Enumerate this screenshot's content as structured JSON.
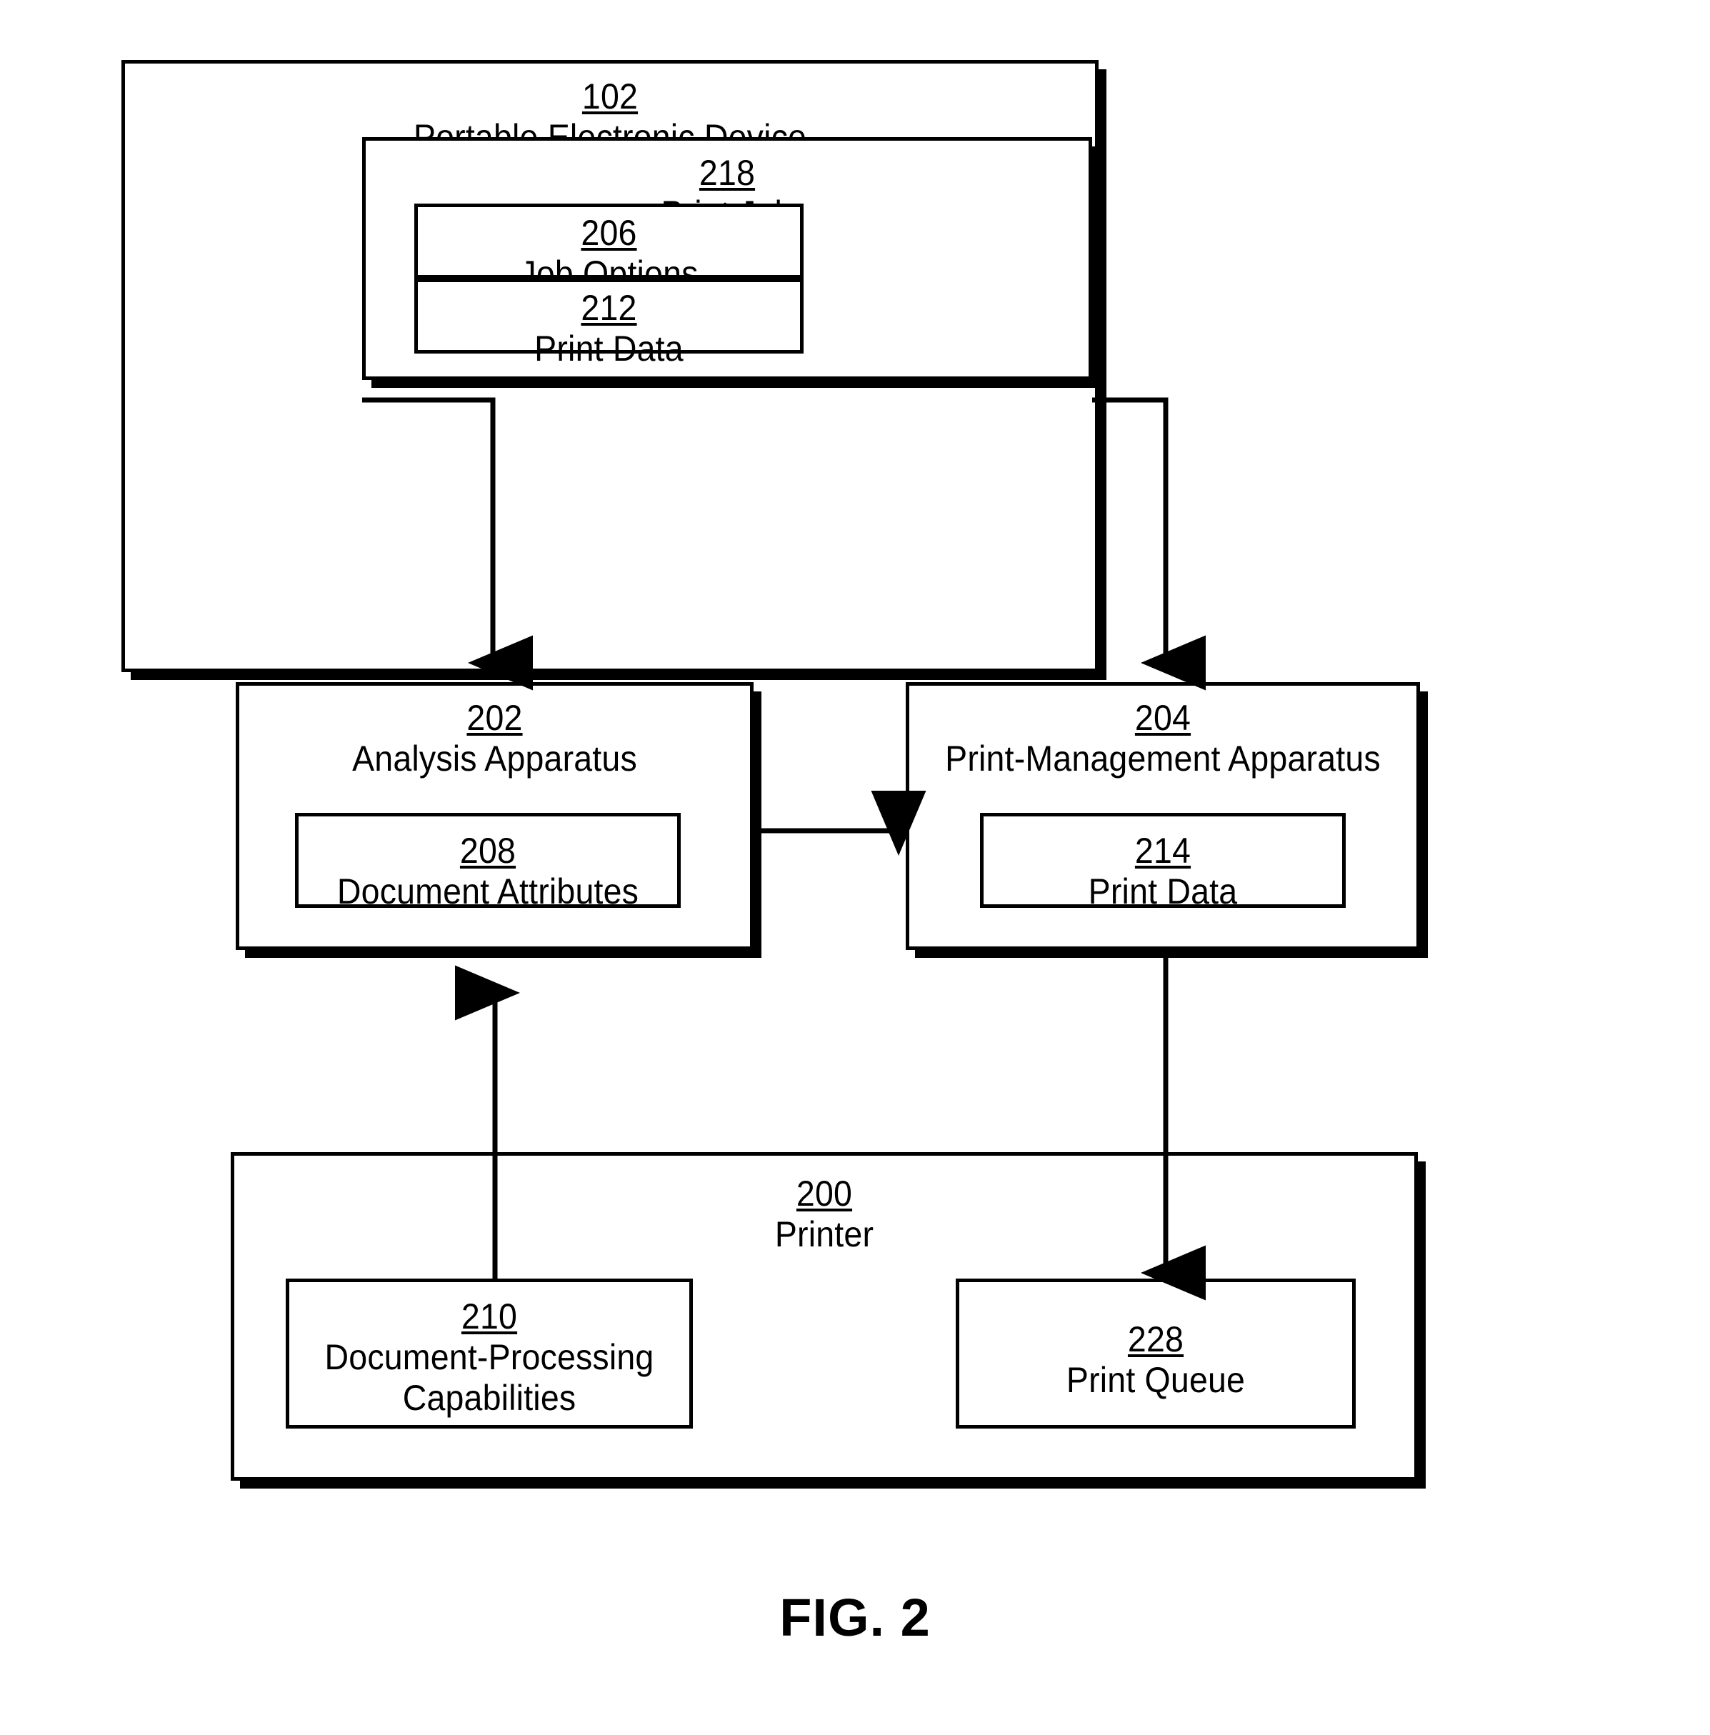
{
  "figure": {
    "caption": "FIG. 2"
  },
  "nodes": {
    "device": {
      "ref": "102",
      "name": "Portable Electronic Device"
    },
    "print_job": {
      "ref": "218",
      "name": "Print Job"
    },
    "job_options": {
      "ref": "206",
      "name": "Job Options"
    },
    "print_data_job": {
      "ref": "212",
      "name": "Print Data"
    },
    "analysis_apparatus": {
      "ref": "202",
      "name": "Analysis Apparatus"
    },
    "document_attributes": {
      "ref": "208",
      "name": "Document Attributes"
    },
    "print_management_apparatus": {
      "ref": "204",
      "name": "Print-Management Apparatus"
    },
    "print_data_mgmt": {
      "ref": "214",
      "name": "Print Data"
    },
    "printer": {
      "ref": "200",
      "name": "Printer"
    },
    "doc_processing_capabilities": {
      "ref": "210",
      "name": "Document-Processing\nCapabilities"
    },
    "print_queue": {
      "ref": "228",
      "name": "Print Queue"
    }
  },
  "connectors": [
    {
      "id": "job-options-to-analysis",
      "from": "job_options",
      "to": "analysis_apparatus",
      "style": "elbow-down-left",
      "arrow": "down"
    },
    {
      "id": "print-data-to-management",
      "from": "print_data_job",
      "to": "print_management_apparatus",
      "style": "elbow-down-right",
      "arrow": "down"
    },
    {
      "id": "analysis-to-management",
      "from": "analysis_apparatus",
      "to": "print_management_apparatus",
      "style": "straight-horizontal",
      "arrow": "right"
    },
    {
      "id": "capabilities-to-analysis",
      "from": "doc_processing_capabilities",
      "to": "analysis_apparatus",
      "style": "straight-vertical",
      "arrow": "up"
    },
    {
      "id": "management-to-queue",
      "from": "print_management_apparatus",
      "to": "print_queue",
      "style": "straight-vertical",
      "arrow": "down"
    }
  ],
  "colors": {
    "stroke": "#000000",
    "fill": "#ffffff"
  }
}
